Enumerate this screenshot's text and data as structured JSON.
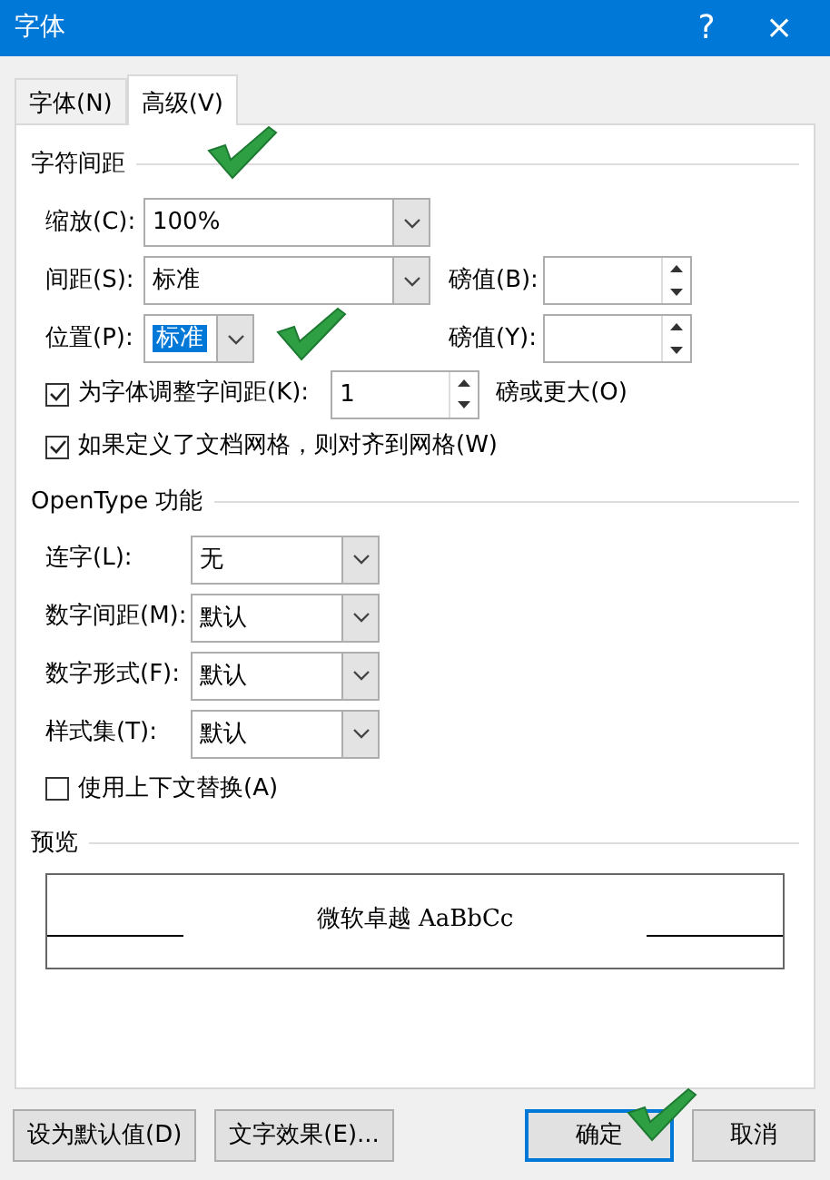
{
  "window": {
    "title": "字体",
    "help": "?",
    "close": "×"
  },
  "tabs": [
    {
      "label": "字体(N)",
      "selected": false
    },
    {
      "label": "高级(V)",
      "selected": true
    }
  ],
  "sections": [
    {
      "title": "字符间距",
      "rows": [
        {
          "kind": "combo",
          "label": "缩放(C):",
          "value": "100%"
        },
        {
          "kind": "combo",
          "label": "间距(S):",
          "value": "标准",
          "spin": {
            "label": "磅值(B):"
          }
        },
        {
          "kind": "short-combo",
          "label": "位置(P):",
          "value": "标准",
          "value_selected": true,
          "spin": {
            "label": "磅值(Y):"
          }
        },
        {
          "kind": "checkbox",
          "label": "为字体调整字间距(K):",
          "checked": true,
          "spin": {
            "value": "1"
          },
          "suffix": "磅或更大(O)"
        },
        {
          "kind": "checkbox",
          "label": "如果定义了文档网格，则对齐到网格(W)",
          "checked": true
        }
      ]
    },
    {
      "title": "OpenType 功能",
      "rows": [
        {
          "kind": "combo",
          "label": "连字(L):",
          "value": "无"
        },
        {
          "kind": "combo",
          "label": "数字间距(M):",
          "value": "默认"
        },
        {
          "kind": "combo",
          "label": "数字形式(F):",
          "value": "默认"
        },
        {
          "kind": "combo",
          "label": "样式集(T):",
          "value": "默认"
        },
        {
          "kind": "checkbox",
          "label": "使用上下文替换(A)",
          "checked": false
        }
      ]
    },
    {
      "title": "预览",
      "rows": [
        {
          "kind": "preview",
          "text": "微软卓越 AaBbCc"
        }
      ]
    }
  ],
  "left_buttons": [
    {
      "label": "设为默认值(D)",
      "default": false
    },
    {
      "label": "文字效果(E)...",
      "default": false
    }
  ],
  "right_buttons": [
    {
      "label": "确定",
      "default": true
    },
    {
      "label": "取消",
      "default": false
    }
  ]
}
